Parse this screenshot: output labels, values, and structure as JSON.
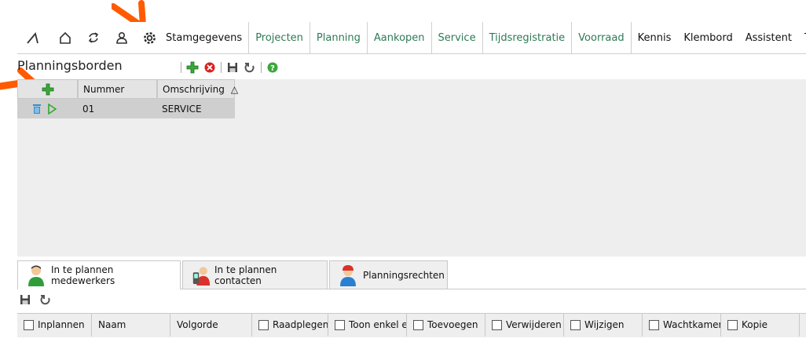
{
  "nav": {
    "icons": [
      "logo-icon",
      "home-icon",
      "sync-icon",
      "user-icon",
      "gear-icon"
    ],
    "menu": [
      {
        "label": "Stamgegevens",
        "style": "plain-border"
      },
      {
        "label": "Projecten",
        "style": "green"
      },
      {
        "label": "Planning",
        "style": "green"
      },
      {
        "label": "Aankopen",
        "style": "green"
      },
      {
        "label": "Service",
        "style": "green"
      },
      {
        "label": "Tijdsregistratie",
        "style": "green"
      },
      {
        "label": "Voorraad",
        "style": "green"
      },
      {
        "label": "Kennis",
        "style": "plain"
      },
      {
        "label": "Klembord",
        "style": "plain"
      },
      {
        "label": "Assistent",
        "style": "plain"
      },
      {
        "label": "Tabel",
        "style": "plain"
      }
    ]
  },
  "panel": {
    "title": "Planningsborden",
    "toolbar_icons": [
      "add-icon",
      "cancel-icon",
      "save-icon",
      "undo-icon",
      "help-icon"
    ]
  },
  "grid": {
    "columns": [
      "Nummer",
      "Omschrijving"
    ],
    "sort_indicator": "△",
    "rows": [
      {
        "nummer": "01",
        "omschrijving": "SERVICE"
      }
    ]
  },
  "tabs": [
    {
      "label": "In te plannen medewerkers",
      "active": true
    },
    {
      "label": "In te plannen contacten",
      "active": false
    },
    {
      "label": "Planningsrechten",
      "active": false
    }
  ],
  "bottom": {
    "toolbar_icons": [
      "save-icon",
      "undo-icon"
    ],
    "columns": [
      {
        "label": "Inplannen",
        "checkbox": true
      },
      {
        "label": "Naam",
        "checkbox": false
      },
      {
        "label": "Volgorde",
        "checkbox": false
      },
      {
        "label": "Raadplegen",
        "checkbox": true
      },
      {
        "label": "Toon enkel ei",
        "checkbox": true
      },
      {
        "label": "Toevoegen",
        "checkbox": true
      },
      {
        "label": "Verwijderen",
        "checkbox": true
      },
      {
        "label": "Wijzigen",
        "checkbox": true
      },
      {
        "label": "Wachtkamer",
        "checkbox": true
      },
      {
        "label": "Kopie",
        "checkbox": true
      }
    ]
  },
  "colors": {
    "accent_green": "#2d7a56",
    "arrow_orange": "#ff5a00",
    "add_green": "#3aa83a"
  }
}
